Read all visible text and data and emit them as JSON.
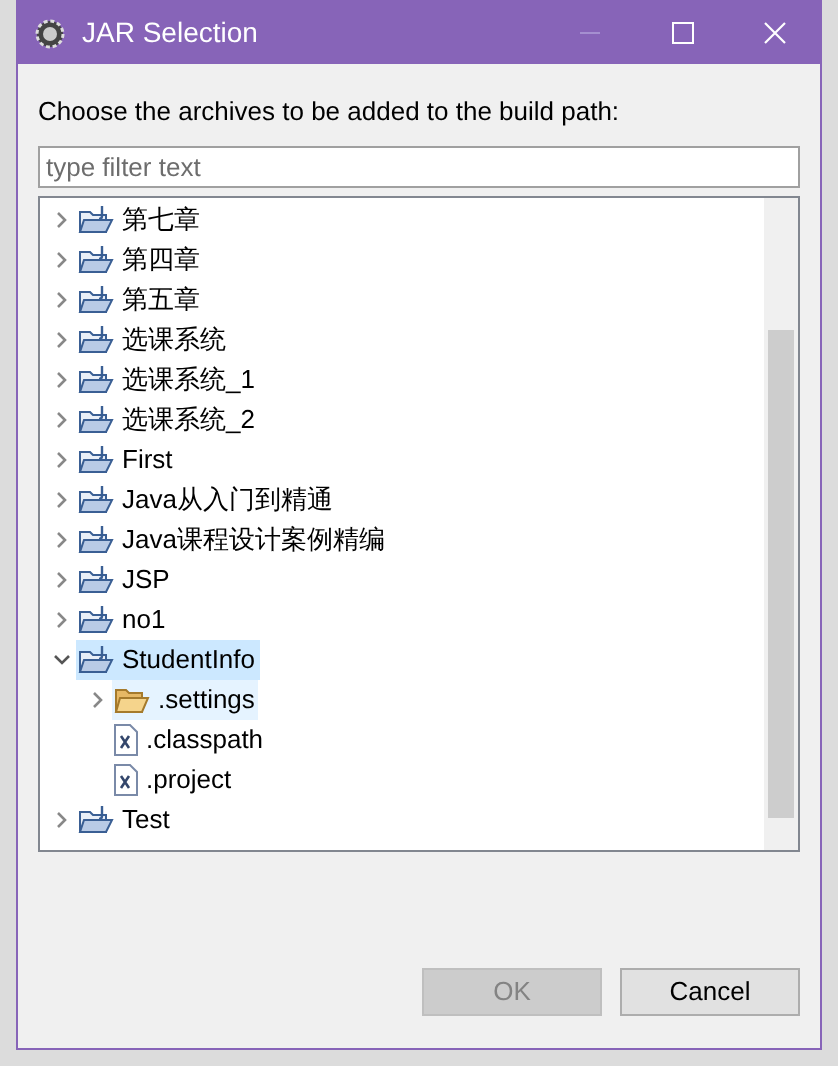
{
  "window": {
    "title": "JAR Selection"
  },
  "prompt": "Choose the archives to be added to the build path:",
  "filter": {
    "placeholder": "type filter text"
  },
  "tree": [
    {
      "label": "第七章",
      "kind": "project",
      "expanded": false,
      "selected": false
    },
    {
      "label": "第四章",
      "kind": "project",
      "expanded": false,
      "selected": false
    },
    {
      "label": "第五章",
      "kind": "project",
      "expanded": false,
      "selected": false
    },
    {
      "label": "选课系统",
      "kind": "project",
      "expanded": false,
      "selected": false
    },
    {
      "label": "选课系统_1",
      "kind": "project",
      "expanded": false,
      "selected": false
    },
    {
      "label": "选课系统_2",
      "kind": "project",
      "expanded": false,
      "selected": false
    },
    {
      "label": "First",
      "kind": "project",
      "expanded": false,
      "selected": false
    },
    {
      "label": "Java从入门到精通",
      "kind": "project",
      "expanded": false,
      "selected": false
    },
    {
      "label": "Java课程设计案例精编",
      "kind": "project",
      "expanded": false,
      "selected": false
    },
    {
      "label": "JSP",
      "kind": "project",
      "expanded": false,
      "selected": false
    },
    {
      "label": "no1",
      "kind": "project",
      "expanded": false,
      "selected": false
    },
    {
      "label": "StudentInfo",
      "kind": "project",
      "expanded": true,
      "selected": true,
      "children": [
        {
          "label": ".settings",
          "kind": "folder",
          "expanded": false,
          "selected": true
        },
        {
          "label": ".classpath",
          "kind": "file",
          "selected": false
        },
        {
          "label": ".project",
          "kind": "file",
          "selected": false
        }
      ]
    },
    {
      "label": "Test",
      "kind": "project",
      "expanded": false,
      "selected": false
    }
  ],
  "buttons": [
    {
      "label": "OK",
      "disabled": true
    },
    {
      "label": "Cancel",
      "disabled": false
    }
  ]
}
